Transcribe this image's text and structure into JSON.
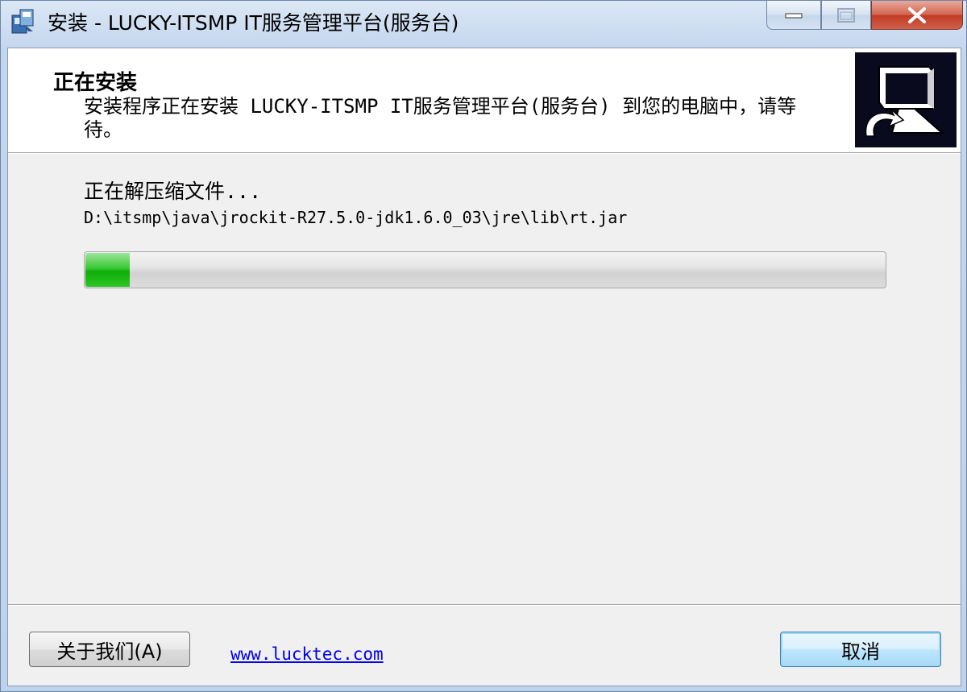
{
  "window": {
    "title": "安装 - LUCKY-ITSMP IT服务管理平台(服务台)"
  },
  "header": {
    "title": "正在安装",
    "description": "安装程序正在安装 LUCKY-ITSMP IT服务管理平台(服务台) 到您的电脑中，请等待。"
  },
  "main": {
    "status_text": "正在解压缩文件...",
    "file_path": "D:\\itsmp\\java\\jrockit-R27.5.0-jdk1.6.0_03\\jre\\lib\\rt.jar",
    "progress_fraction": 0.055
  },
  "footer": {
    "about_label": "关于我们(A)",
    "link_text": "www.lucktec.com",
    "cancel_label": "取消"
  },
  "colors": {
    "progress_fill": "#0fae0a",
    "link": "#0000ee"
  },
  "icons": {
    "app": "installer-icon",
    "header_image": "computer-install-icon",
    "minimize": "minimize-icon",
    "maximize": "maximize-icon",
    "close": "close-icon"
  }
}
